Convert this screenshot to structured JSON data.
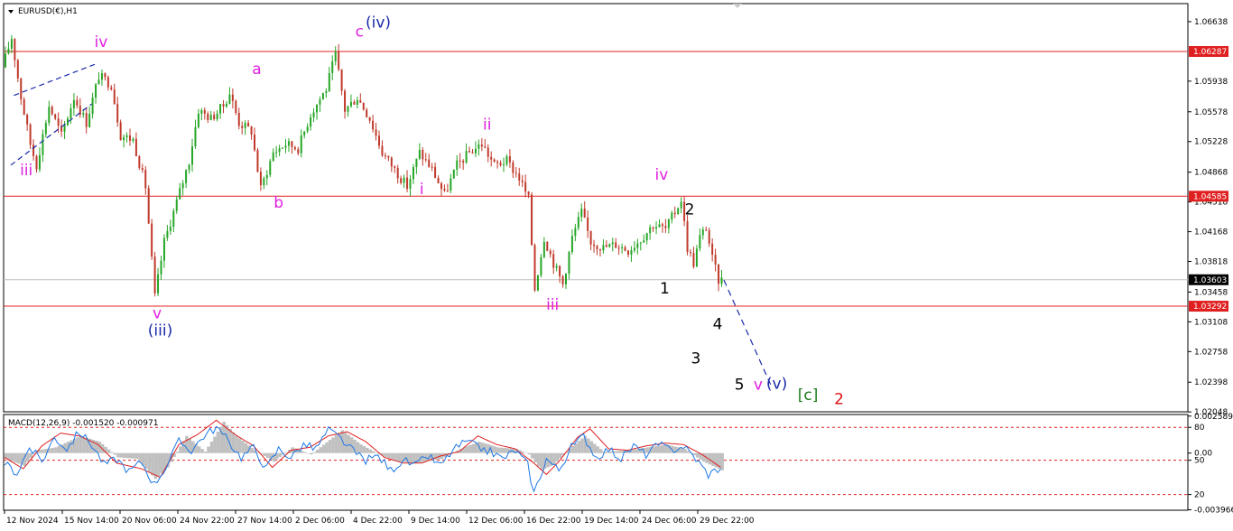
{
  "window": {
    "title": "EURUSD(€),H1",
    "menu_icon": "triangle-down-icon"
  },
  "colors": {
    "background": "#ffffff",
    "bull_candle": "#26a626",
    "bear_candle": "#c0392b",
    "level_line": "#e02020",
    "current_price_line": "#c0c0c0",
    "trend_line": "#1a2aa8",
    "macd_hist": "#c0c0c0",
    "macd_line": "#1e78e6",
    "signal_line": "#e02020",
    "magenta_label": "#e020e0",
    "blue_label": "#1a2aa8",
    "black_label": "#000000",
    "green_label": "#1a7a1a",
    "red_label": "#e01010",
    "axis": "#000000"
  },
  "chart_data": [
    {
      "type": "candlestick",
      "title": "EURUSD(€),H1",
      "ylim": [
        1.0205,
        1.0685
      ],
      "y_ticks": [
        "1.06638",
        "1.05938",
        "1.05578",
        "1.05228",
        "1.04868",
        "1.04518",
        "1.04168",
        "1.03818",
        "1.03458",
        "1.03108",
        "1.02758",
        "1.02398",
        "1.02048"
      ],
      "x_ticks": [
        "12 Nov 2024",
        "15 Nov 14:00",
        "20 Nov 06:00",
        "24 Nov 22:00",
        "27 Nov 14:00",
        "2 Dec 06:00",
        "4 Dec 22:00",
        "9 Dec 14:00",
        "12 Dec 06:00",
        "16 Dec 22:00",
        "19 Dec 14:00",
        "24 Dec 06:00",
        "29 Dec 22:00"
      ],
      "horizontal_levels": [
        {
          "price": 1.06287,
          "label": "1.06287"
        },
        {
          "price": 1.04585,
          "label": "1.04585"
        },
        {
          "price": 1.03292,
          "label": "1.03292"
        }
      ],
      "current_price": {
        "price": 1.03603,
        "label": "1.03603"
      },
      "path_keypoints": [
        [
          0,
          1.061
        ],
        [
          3,
          1.0645
        ],
        [
          6,
          1.0575
        ],
        [
          9,
          1.052
        ],
        [
          11,
          1.0495
        ],
        [
          15,
          1.0565
        ],
        [
          19,
          1.053
        ],
        [
          23,
          1.0575
        ],
        [
          27,
          1.0545
        ],
        [
          31,
          1.06
        ],
        [
          35,
          1.059
        ],
        [
          38,
          1.053
        ],
        [
          42,
          1.0525
        ],
        [
          46,
          1.047
        ],
        [
          49,
          1.034
        ],
        [
          52,
          1.0405
        ],
        [
          55,
          1.044
        ],
        [
          60,
          1.05
        ],
        [
          63,
          1.056
        ],
        [
          67,
          1.055
        ],
        [
          71,
          1.0565
        ],
        [
          73,
          1.058
        ],
        [
          76,
          1.0545
        ],
        [
          80,
          1.0535
        ],
        [
          83,
          1.0467
        ],
        [
          87,
          1.051
        ],
        [
          91,
          1.052
        ],
        [
          95,
          1.0515
        ],
        [
          99,
          1.0555
        ],
        [
          104,
          1.0585
        ],
        [
          107,
          1.0625
        ],
        [
          110,
          1.056
        ],
        [
          114,
          1.0575
        ],
        [
          118,
          1.055
        ],
        [
          122,
          1.051
        ],
        [
          126,
          1.049
        ],
        [
          130,
          1.047
        ],
        [
          134,
          1.051
        ],
        [
          138,
          1.049
        ],
        [
          142,
          1.046
        ],
        [
          146,
          1.0495
        ],
        [
          150,
          1.051
        ],
        [
          154,
          1.052
        ],
        [
          158,
          1.0495
        ],
        [
          162,
          1.05
        ],
        [
          166,
          1.048
        ],
        [
          169,
          1.0455
        ],
        [
          171,
          1.035
        ],
        [
          174,
          1.041
        ],
        [
          177,
          1.038
        ],
        [
          180,
          1.0355
        ],
        [
          183,
          1.041
        ],
        [
          186,
          1.044
        ],
        [
          189,
          1.0405
        ],
        [
          193,
          1.0398
        ],
        [
          197,
          1.0402
        ],
        [
          201,
          1.0395
        ],
        [
          205,
          1.0408
        ],
        [
          209,
          1.0425
        ],
        [
          213,
          1.042
        ],
        [
          216,
          1.044
        ],
        [
          218,
          1.0455
        ],
        [
          220,
          1.0398
        ],
        [
          222,
          1.038
        ],
        [
          224,
          1.041
        ],
        [
          226,
          1.0422
        ],
        [
          228,
          1.0385
        ],
        [
          230,
          1.036
        ]
      ],
      "projection_line": [
        [
          231,
          1.036
        ],
        [
          246,
          1.0237
        ]
      ],
      "trend_channel": [
        {
          "from": [
            2,
            1.0495
          ],
          "to": [
            28,
            1.0567
          ]
        },
        {
          "from": [
            3,
            1.0577
          ],
          "to": [
            30,
            1.0615
          ]
        }
      ],
      "wave_labels": [
        {
          "text": "iii",
          "color": "magenta",
          "at": [
            7,
            1.0483
          ]
        },
        {
          "text": "iv",
          "color": "magenta",
          "at": [
            31,
            1.0634
          ]
        },
        {
          "text": "v",
          "color": "magenta",
          "at": [
            49,
            1.0315
          ]
        },
        {
          "text": "(iii)",
          "color": "blue",
          "at": [
            50,
            1.0295
          ]
        },
        {
          "text": "a",
          "color": "magenta",
          "at": [
            81,
            1.0602
          ]
        },
        {
          "text": "b",
          "color": "magenta",
          "at": [
            88,
            1.0445
          ]
        },
        {
          "text": "c",
          "color": "magenta",
          "at": [
            114,
            1.0646
          ]
        },
        {
          "text": "(iv)",
          "color": "blue",
          "at": [
            120,
            1.0657
          ]
        },
        {
          "text": "ii",
          "color": "magenta",
          "at": [
            155,
            1.0537
          ]
        },
        {
          "text": "i",
          "color": "magenta",
          "at": [
            134,
            1.0461
          ]
        },
        {
          "text": "iii",
          "color": "magenta",
          "at": [
            176,
            1.0325
          ]
        },
        {
          "text": "iv",
          "color": "magenta",
          "at": [
            211,
            1.0478
          ]
        },
        {
          "text": "2",
          "color": "black",
          "at": [
            220,
            1.0437
          ]
        },
        {
          "text": "1",
          "color": "black",
          "at": [
            212,
            1.0344
          ]
        },
        {
          "text": "4",
          "color": "black",
          "at": [
            229,
            1.0302
          ]
        },
        {
          "text": "3",
          "color": "black",
          "at": [
            222,
            1.0262
          ]
        },
        {
          "text": "5",
          "color": "black",
          "at": [
            236,
            1.0231
          ]
        },
        {
          "text": "v",
          "color": "magenta",
          "at": [
            242,
            1.0231
          ]
        },
        {
          "text": "(v)",
          "color": "blue",
          "at": [
            248,
            1.0232
          ]
        },
        {
          "text": "[c]",
          "color": "green",
          "at": [
            258,
            1.0219
          ]
        },
        {
          "text": "2",
          "color": "red",
          "at": [
            268,
            1.0214
          ]
        }
      ]
    },
    {
      "type": "line",
      "title": "MACD(12,26,9) -0.001520 -0.000971",
      "ylim": [
        -0.004,
        0.0027
      ],
      "y_ticks": [
        "0.002589",
        "80",
        "0.00",
        "50",
        "20",
        "-0.003966"
      ],
      "levels": [
        0.0018,
        -0.0005,
        -0.0029
      ],
      "histogram_keypoints": [
        [
          0,
          -0.0004
        ],
        [
          6,
          -0.0009
        ],
        [
          10,
          0.0002
        ],
        [
          16,
          0.0004
        ],
        [
          24,
          0.0012
        ],
        [
          30,
          0.0008
        ],
        [
          36,
          -0.0003
        ],
        [
          42,
          -0.0004
        ],
        [
          48,
          -0.0018
        ],
        [
          52,
          -0.001
        ],
        [
          58,
          0.0012
        ],
        [
          64,
          0.0001
        ],
        [
          70,
          0.0022
        ],
        [
          74,
          0.0012
        ],
        [
          80,
          0.0002
        ],
        [
          86,
          -0.0006
        ],
        [
          92,
          0.0004
        ],
        [
          98,
          -0.0001
        ],
        [
          108,
          0.0016
        ],
        [
          114,
          0.0006
        ],
        [
          120,
          -0.0001
        ],
        [
          126,
          -0.0006
        ],
        [
          132,
          -0.0007
        ],
        [
          140,
          -0.0004
        ],
        [
          146,
          0.0003
        ],
        [
          152,
          0.0008
        ],
        [
          158,
          0.0004
        ],
        [
          164,
          0.0003
        ],
        [
          168,
          -0.0001
        ],
        [
          172,
          -0.0012
        ],
        [
          176,
          -0.0008
        ],
        [
          182,
          0.0005
        ],
        [
          186,
          0.0012
        ],
        [
          192,
          0.0001
        ],
        [
          200,
          0.0002
        ],
        [
          206,
          0.0004
        ],
        [
          212,
          0.0006
        ],
        [
          218,
          0.0003
        ],
        [
          224,
          -0.0006
        ],
        [
          230,
          -0.0012
        ]
      ],
      "signal_keypoints": [
        [
          0,
          -0.0003
        ],
        [
          6,
          -0.0011
        ],
        [
          12,
          0.0005
        ],
        [
          18,
          0.0014
        ],
        [
          24,
          0.0012
        ],
        [
          30,
          0.0006
        ],
        [
          36,
          -0.0007
        ],
        [
          44,
          -0.0011
        ],
        [
          50,
          -0.0017
        ],
        [
          56,
          0.0006
        ],
        [
          62,
          0.0013
        ],
        [
          68,
          0.0023
        ],
        [
          74,
          0.0013
        ],
        [
          80,
          0.0005
        ],
        [
          86,
          -0.001
        ],
        [
          92,
          0.0002
        ],
        [
          98,
          0.0004
        ],
        [
          104,
          0.0012
        ],
        [
          110,
          0.0015
        ],
        [
          116,
          0.0008
        ],
        [
          122,
          -0.0003
        ],
        [
          128,
          -0.0007
        ],
        [
          134,
          -0.0007
        ],
        [
          140,
          -0.0002
        ],
        [
          146,
          0.0001
        ],
        [
          152,
          0.0012
        ],
        [
          158,
          0.0006
        ],
        [
          164,
          0.0003
        ],
        [
          170,
          -0.0007
        ],
        [
          174,
          -0.0015
        ],
        [
          178,
          -0.0006
        ],
        [
          184,
          0.0011
        ],
        [
          188,
          0.0017
        ],
        [
          194,
          0.0003
        ],
        [
          200,
          0.0002
        ],
        [
          206,
          0.0005
        ],
        [
          212,
          0.0007
        ],
        [
          218,
          0.0006
        ],
        [
          224,
          -0.0001
        ],
        [
          230,
          -0.001
        ]
      ],
      "macd_keypoints": [
        [
          0,
          -0.0007
        ],
        [
          4,
          -0.0014
        ],
        [
          8,
          0.0004
        ],
        [
          12,
          -0.0006
        ],
        [
          16,
          0.0011
        ],
        [
          20,
          0.0003
        ],
        [
          24,
          0.0015
        ],
        [
          28,
          0.0006
        ],
        [
          32,
          -0.0008
        ],
        [
          36,
          -0.0004
        ],
        [
          40,
          -0.0013
        ],
        [
          44,
          -0.0006
        ],
        [
          48,
          -0.0022
        ],
        [
          52,
          -0.0009
        ],
        [
          56,
          0.0008
        ],
        [
          60,
          0.0002
        ],
        [
          64,
          0.0012
        ],
        [
          68,
          0.0018
        ],
        [
          72,
          0.0008
        ],
        [
          76,
          -0.0003
        ],
        [
          80,
          0.0004
        ],
        [
          84,
          -0.0011
        ],
        [
          88,
          0.0003
        ],
        [
          92,
          -0.0003
        ],
        [
          96,
          0.0006
        ],
        [
          100,
          0.0003
        ],
        [
          104,
          0.0016
        ],
        [
          108,
          0.001
        ],
        [
          112,
          0.0001
        ],
        [
          116,
          -0.0005
        ],
        [
          120,
          -0.0002
        ],
        [
          124,
          -0.0012
        ],
        [
          128,
          -0.0005
        ],
        [
          132,
          -0.0009
        ],
        [
          136,
          -0.0002
        ],
        [
          140,
          -0.0009
        ],
        [
          144,
          0.0002
        ],
        [
          148,
          0.0008
        ],
        [
          152,
          0.0004
        ],
        [
          156,
          0.0001
        ],
        [
          160,
          -0.0004
        ],
        [
          164,
          0.0002
        ],
        [
          168,
          -0.0008
        ],
        [
          170,
          -0.0028
        ],
        [
          174,
          -0.0004
        ],
        [
          178,
          -0.0012
        ],
        [
          182,
          0.0004
        ],
        [
          186,
          0.0012
        ],
        [
          190,
          -0.0003
        ],
        [
          194,
          0.0003
        ],
        [
          198,
          -0.0004
        ],
        [
          202,
          0.0005
        ],
        [
          206,
          -0.0001
        ],
        [
          210,
          0.0006
        ],
        [
          214,
          0.0002
        ],
        [
          218,
          0.0005
        ],
        [
          222,
          -0.0004
        ],
        [
          226,
          -0.0015
        ],
        [
          230,
          -0.001
        ]
      ]
    }
  ]
}
